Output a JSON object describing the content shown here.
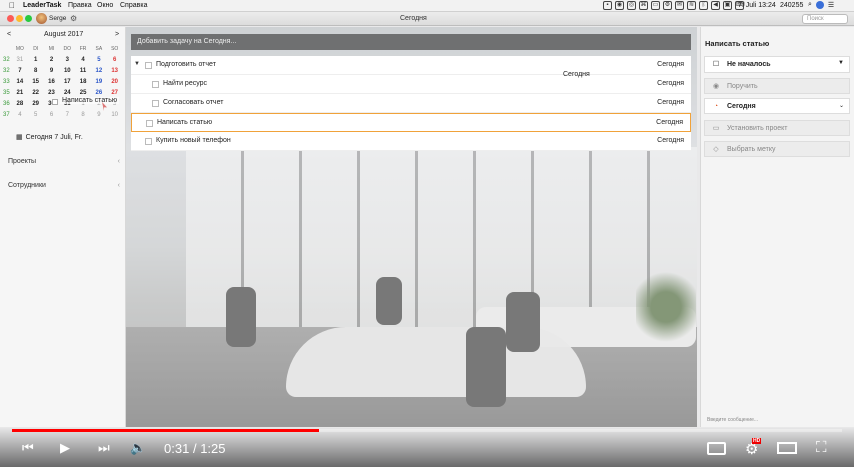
{
  "menubar": {
    "apple": "",
    "app_name": "LeaderTask",
    "menus": [
      "Правка",
      "Окно",
      "Справка"
    ],
    "date": "7. Juli 13:24",
    "value": "240255"
  },
  "titlebar": {
    "user": "Serge",
    "title": "Сегодня",
    "search_placeholder": "Поиск"
  },
  "calendar": {
    "prev": "<",
    "month": "August 2017",
    "next": ">",
    "dow": [
      "MO",
      "DI",
      "MI",
      "DO",
      "FR",
      "SA",
      "SO"
    ],
    "weeks": [
      {
        "wk": "32",
        "days": [
          "31",
          "1",
          "2",
          "3",
          "4",
          "5",
          "6"
        ]
      },
      {
        "wk": "32",
        "days": [
          "7",
          "8",
          "9",
          "10",
          "11",
          "12",
          "13"
        ]
      },
      {
        "wk": "33",
        "days": [
          "14",
          "15",
          "16",
          "17",
          "18",
          "19",
          "20"
        ]
      },
      {
        "wk": "35",
        "days": [
          "21",
          "22",
          "23",
          "24",
          "25",
          "26",
          "27"
        ]
      },
      {
        "wk": "36",
        "days": [
          "28",
          "29",
          "30",
          "31",
          "1",
          "2",
          "3"
        ]
      },
      {
        "wk": "37",
        "days": [
          "4",
          "5",
          "6",
          "7",
          "8",
          "9",
          "10"
        ]
      }
    ]
  },
  "sidebar": {
    "drag_tooltip": "Написать статью",
    "today": "Сегодня 7 Juli, Fr.",
    "sections": [
      "Проекты",
      "Сотрудники"
    ]
  },
  "main": {
    "add_placeholder": "Добавить задачу на Сегодня...",
    "drag_target": "Сегодня",
    "tasks": [
      {
        "name": "Подготовить отчет",
        "date": "Сегодня"
      },
      {
        "name": "Найти ресурс",
        "date": "Сегодня"
      },
      {
        "name": "Согласовать отчет",
        "date": "Сегодня"
      },
      {
        "name": "Написать статью",
        "date": "Сегодня"
      },
      {
        "name": "Купить новый телефон",
        "date": "Сегодня"
      }
    ]
  },
  "detail": {
    "title": "Написать статью",
    "status": "Не началось",
    "assign": "Поручить",
    "due": "Сегодня",
    "project": "Установить проект",
    "tag": "Выбрать метку",
    "comment_placeholder": "Введите сообщение..."
  },
  "video": {
    "progress_fraction": 0.37,
    "current": "0:31",
    "sep": "/",
    "duration": "1:25",
    "hd": "HD"
  },
  "colors": {
    "accent_progress": "#ff0000",
    "selected_border": "#f0a23a",
    "today_red": "#e54a4a"
  }
}
